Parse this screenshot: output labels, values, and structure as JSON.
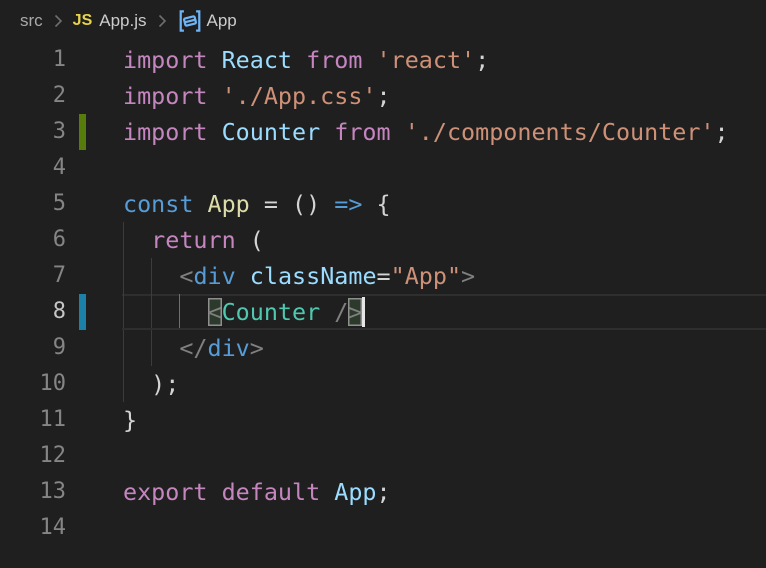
{
  "app": {
    "name": "code-editor",
    "theme_background": "#1f1f1f"
  },
  "breadcrumb": {
    "folder": "src",
    "file": "App.js",
    "file_badge": "JS",
    "symbol": "App",
    "separator": ">",
    "colors": {
      "file_badge": "#e8d44d",
      "symbol_icon": "#6fb4f5",
      "text": "#a9a9a9"
    }
  },
  "editor": {
    "language": "javascript",
    "active_line": 8,
    "cursor": {
      "line": 8,
      "col": 17
    },
    "colors": {
      "background": "#1f1f1f",
      "line_number": "#858585",
      "line_number_active": "#c6c6c6",
      "git_added_bar": "#587c0c",
      "git_modified_bar": "#1b81a8",
      "tokens": {
        "keyword": "#C586C0",
        "storage": "#569CD6",
        "variable": "#9CDCFE",
        "function": "#DCDCAA",
        "string": "#CE9178",
        "plain": "#D4D4D4",
        "punct": "#808080",
        "tag": "#569CD6",
        "component": "#4EC9B0"
      }
    },
    "gutter": {
      "added": [
        3
      ],
      "modified": [
        8
      ]
    },
    "indent_guides": {
      "by_line": {
        "6": [
          0
        ],
        "7": [
          0,
          2
        ],
        "8": [
          0,
          2,
          4
        ],
        "9": [
          0,
          2
        ],
        "10": [
          0
        ]
      },
      "active": {
        "line": 8,
        "col": 4
      }
    },
    "lines": [
      {
        "n": 1,
        "tokens": [
          [
            "import",
            "keyword"
          ],
          [
            " ",
            "plain"
          ],
          [
            "React",
            "variable"
          ],
          [
            " ",
            "plain"
          ],
          [
            "from",
            "keyword"
          ],
          [
            " ",
            "plain"
          ],
          [
            "'react'",
            "string"
          ],
          [
            ";",
            "plain"
          ]
        ]
      },
      {
        "n": 2,
        "tokens": [
          [
            "import",
            "keyword"
          ],
          [
            " ",
            "plain"
          ],
          [
            "'./App.css'",
            "string"
          ],
          [
            ";",
            "plain"
          ]
        ]
      },
      {
        "n": 3,
        "tokens": [
          [
            "import",
            "keyword"
          ],
          [
            " ",
            "plain"
          ],
          [
            "Counter",
            "variable"
          ],
          [
            " ",
            "plain"
          ],
          [
            "from",
            "keyword"
          ],
          [
            " ",
            "plain"
          ],
          [
            "'./components/Counter'",
            "string"
          ],
          [
            ";",
            "plain"
          ]
        ]
      },
      {
        "n": 4,
        "tokens": []
      },
      {
        "n": 5,
        "tokens": [
          [
            "const",
            "storage"
          ],
          [
            " ",
            "plain"
          ],
          [
            "App",
            "function"
          ],
          [
            " = () ",
            "plain"
          ],
          [
            "=>",
            "storage"
          ],
          [
            " {",
            "plain"
          ]
        ]
      },
      {
        "n": 6,
        "tokens": [
          [
            "  ",
            "plain"
          ],
          [
            "return",
            "keyword"
          ],
          [
            " (",
            "plain"
          ]
        ]
      },
      {
        "n": 7,
        "tokens": [
          [
            "    ",
            "plain"
          ],
          [
            "<",
            "punct"
          ],
          [
            "div",
            "tag"
          ],
          [
            " ",
            "plain"
          ],
          [
            "className",
            "variable"
          ],
          [
            "=",
            "plain"
          ],
          [
            "\"App\"",
            "string"
          ],
          [
            ">",
            "punct"
          ]
        ]
      },
      {
        "n": 8,
        "tokens": [
          [
            "      ",
            "plain"
          ],
          [
            "<",
            "punct",
            true
          ],
          [
            "Counter",
            "component"
          ],
          [
            " ",
            "plain"
          ],
          [
            "/",
            "punct"
          ],
          [
            ">",
            "punct",
            true
          ]
        ]
      },
      {
        "n": 9,
        "tokens": [
          [
            "    ",
            "plain"
          ],
          [
            "</",
            "punct"
          ],
          [
            "div",
            "tag"
          ],
          [
            ">",
            "punct"
          ]
        ]
      },
      {
        "n": 10,
        "tokens": [
          [
            "  ",
            "plain"
          ],
          [
            ");",
            "plain"
          ]
        ]
      },
      {
        "n": 11,
        "tokens": [
          [
            "}",
            "plain"
          ]
        ]
      },
      {
        "n": 12,
        "tokens": []
      },
      {
        "n": 13,
        "tokens": [
          [
            "export",
            "keyword"
          ],
          [
            " ",
            "plain"
          ],
          [
            "default",
            "keyword"
          ],
          [
            " ",
            "plain"
          ],
          [
            "App",
            "variable"
          ],
          [
            ";",
            "plain"
          ]
        ]
      },
      {
        "n": 14,
        "tokens": []
      }
    ]
  }
}
